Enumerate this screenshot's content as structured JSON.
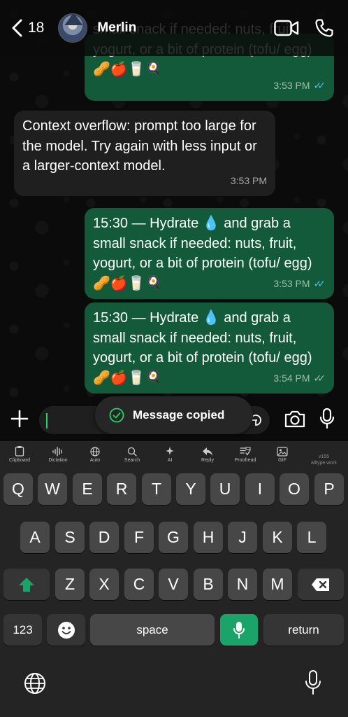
{
  "header": {
    "back_count": "18",
    "contact_name": "Merlin"
  },
  "messages": [
    {
      "id": "m1",
      "direction": "outgoing",
      "text": "small snack if needed: nuts, fruit, yogurt, or a bit of protein (tofu/ egg) 🥜🍎🥛🍳",
      "time": "3:53 PM",
      "status": "read"
    },
    {
      "id": "m2",
      "direction": "incoming",
      "text": "Context overflow: prompt too large for the model. Try again with less input or a larger-context model.",
      "time": "3:53 PM"
    },
    {
      "id": "m3",
      "direction": "outgoing",
      "text": "15:30 — Hydrate 💧 and grab a small snack if needed: nuts, fruit, yogurt, or a bit of protein (tofu/ egg) 🥜🍎🥛🍳",
      "time": "3:53 PM",
      "status": "read"
    },
    {
      "id": "m4",
      "direction": "outgoing",
      "text": "15:30 — Hydrate 💧 and grab a small snack if needed: nuts, fruit, yogurt, or a bit of protein (tofu/ egg) 🥜🍎🥛🍳",
      "time": "3:54 PM",
      "status": "delivered"
    }
  ],
  "toast": {
    "text": "Message copied"
  },
  "keyboard": {
    "toolbar": [
      {
        "label": "Clipboard",
        "icon": "clipboard-icon"
      },
      {
        "label": "Dictation",
        "icon": "waveform-icon"
      },
      {
        "label": "Auto",
        "icon": "globe-icon"
      },
      {
        "label": "Search",
        "icon": "search-icon"
      },
      {
        "label": "AI",
        "icon": "sparkle-icon"
      },
      {
        "label": "Reply",
        "icon": "reply-icon"
      },
      {
        "label": "Proofread",
        "icon": "proofread-icon"
      },
      {
        "label": "GIF",
        "icon": "gif-icon"
      }
    ],
    "version_line1": "v155",
    "version_line2": "alltype.work",
    "row1": [
      "Q",
      "W",
      "E",
      "R",
      "T",
      "Y",
      "U",
      "I",
      "O",
      "P"
    ],
    "row2": [
      "A",
      "S",
      "D",
      "F",
      "G",
      "H",
      "J",
      "K",
      "L"
    ],
    "row3": [
      "Z",
      "X",
      "C",
      "V",
      "B",
      "N",
      "M"
    ],
    "numbers_label": "123",
    "space_label": "space",
    "return_label": "return",
    "accent_color": "#1aa46a"
  }
}
